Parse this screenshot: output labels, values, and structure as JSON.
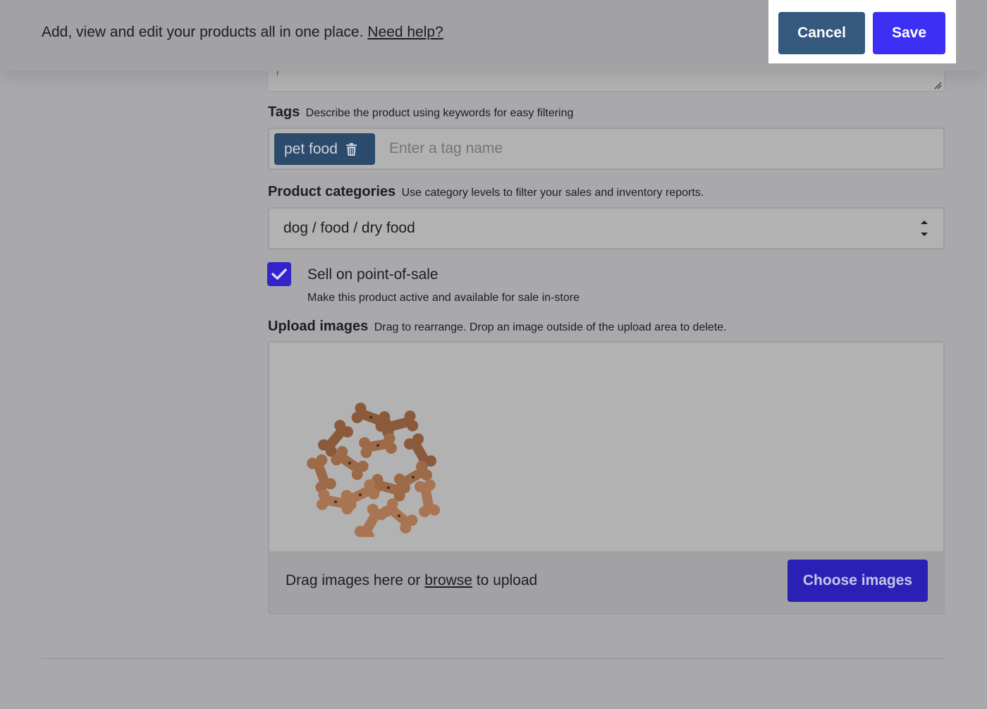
{
  "header": {
    "description": "Add, view and edit your products all in one place.",
    "help_link": "Need help?",
    "cancel_label": "Cancel",
    "save_label": "Save"
  },
  "description_field": {
    "partial_text": "r"
  },
  "tags": {
    "label": "Tags",
    "help": "Describe the product using keywords for easy filtering",
    "items": [
      {
        "label": "pet food",
        "icon": "trash-icon"
      }
    ],
    "placeholder": "Enter a tag name"
  },
  "categories": {
    "label": "Product categories",
    "help": "Use category levels to filter your sales and inventory reports.",
    "selected": "dog / food / dry food"
  },
  "pos": {
    "label": "Sell on point-of-sale",
    "help": "Make this product active and available for sale in-store",
    "checked": true
  },
  "upload": {
    "label": "Upload images",
    "help": "Drag to rearrange. Drop an image outside of the upload area to delete.",
    "footer_prefix": "Drag images here or ",
    "footer_link": "browse",
    "footer_suffix": " to upload",
    "choose_label": "Choose images"
  },
  "colors": {
    "save": "#3d30f5",
    "cancel": "#35587f",
    "checkbox": "#3324c9",
    "choose": "#2b20b5",
    "tag_chip": "#2c4a6b"
  }
}
